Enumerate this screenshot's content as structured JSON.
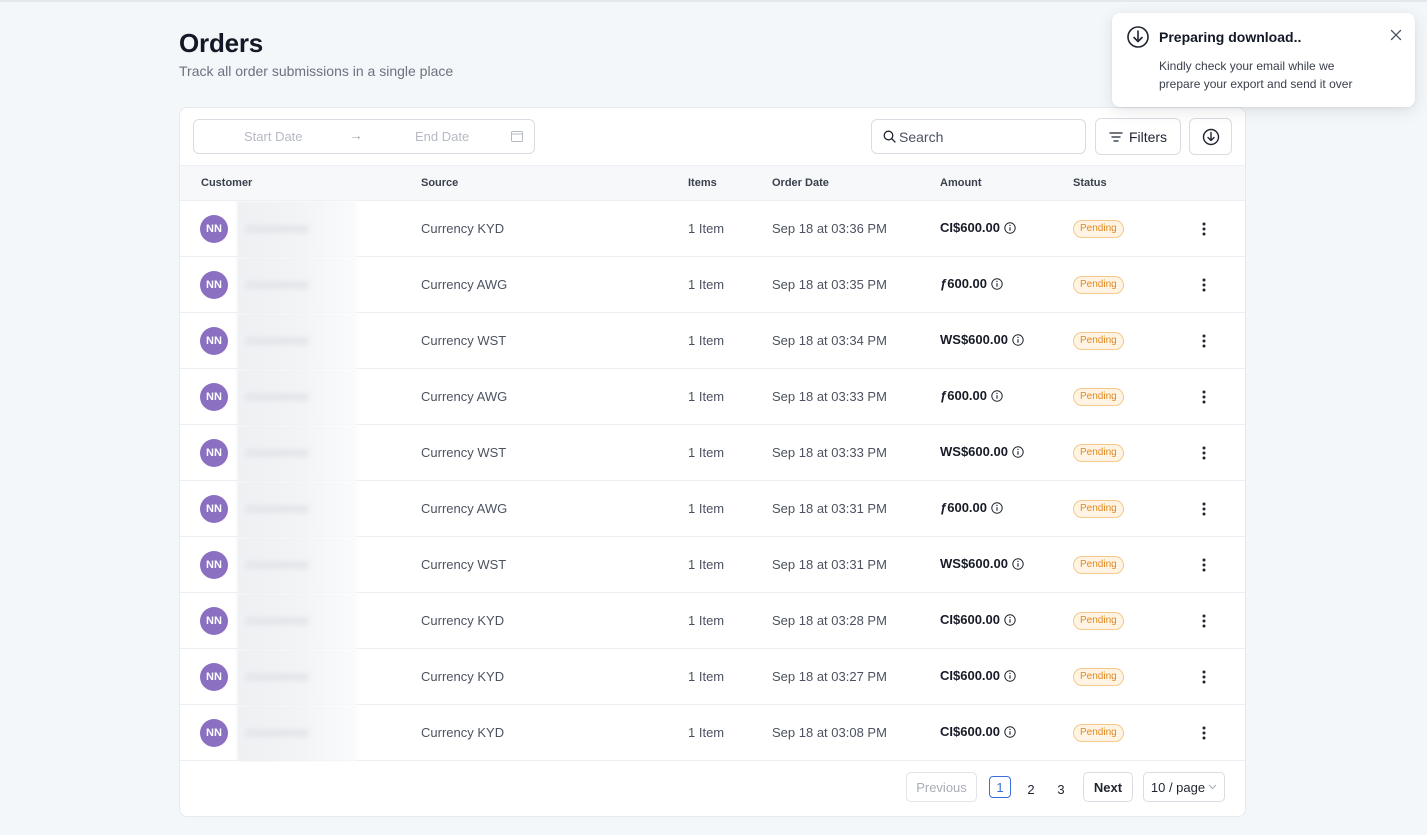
{
  "header": {
    "title": "Orders",
    "subtitle": "Track all order submissions in a single place"
  },
  "toolbar": {
    "start_date_placeholder": "Start Date",
    "end_date_placeholder": "End Date",
    "search_placeholder": "Search",
    "filters_label": "Filters"
  },
  "table": {
    "columns": [
      "Customer",
      "Source",
      "Items",
      "Order Date",
      "Amount",
      "Status"
    ],
    "rows": [
      {
        "initials": "NN",
        "source": "Currency KYD",
        "items": "1 Item",
        "date": "Sep 18 at 03:36 PM",
        "amount": "CI$600.00",
        "status": "Pending"
      },
      {
        "initials": "NN",
        "source": "Currency AWG",
        "items": "1 Item",
        "date": "Sep 18 at 03:35 PM",
        "amount": "ƒ600.00",
        "status": "Pending"
      },
      {
        "initials": "NN",
        "source": "Currency WST",
        "items": "1 Item",
        "date": "Sep 18 at 03:34 PM",
        "amount": "WS$600.00",
        "status": "Pending"
      },
      {
        "initials": "NN",
        "source": "Currency AWG",
        "items": "1 Item",
        "date": "Sep 18 at 03:33 PM",
        "amount": "ƒ600.00",
        "status": "Pending"
      },
      {
        "initials": "NN",
        "source": "Currency WST",
        "items": "1 Item",
        "date": "Sep 18 at 03:33 PM",
        "amount": "WS$600.00",
        "status": "Pending"
      },
      {
        "initials": "NN",
        "source": "Currency AWG",
        "items": "1 Item",
        "date": "Sep 18 at 03:31 PM",
        "amount": "ƒ600.00",
        "status": "Pending"
      },
      {
        "initials": "NN",
        "source": "Currency WST",
        "items": "1 Item",
        "date": "Sep 18 at 03:31 PM",
        "amount": "WS$600.00",
        "status": "Pending"
      },
      {
        "initials": "NN",
        "source": "Currency KYD",
        "items": "1 Item",
        "date": "Sep 18 at 03:28 PM",
        "amount": "CI$600.00",
        "status": "Pending"
      },
      {
        "initials": "NN",
        "source": "Currency KYD",
        "items": "1 Item",
        "date": "Sep 18 at 03:27 PM",
        "amount": "CI$600.00",
        "status": "Pending"
      },
      {
        "initials": "NN",
        "source": "Currency KYD",
        "items": "1 Item",
        "date": "Sep 18 at 03:08 PM",
        "amount": "CI$600.00",
        "status": "Pending"
      }
    ]
  },
  "pagination": {
    "previous_label": "Previous",
    "pages": [
      "1",
      "2",
      "3"
    ],
    "current_page": "1",
    "next_label": "Next",
    "per_page_label": "10 / page"
  },
  "toast": {
    "title": "Preparing download..",
    "body": "Kindly check your email while we prepare your export and send it over"
  },
  "colors": {
    "avatar": "#8b6fc1",
    "status_pending_text": "#e08a1e",
    "status_pending_bg": "#fff4e4",
    "active_page": "#3a6fd8"
  }
}
